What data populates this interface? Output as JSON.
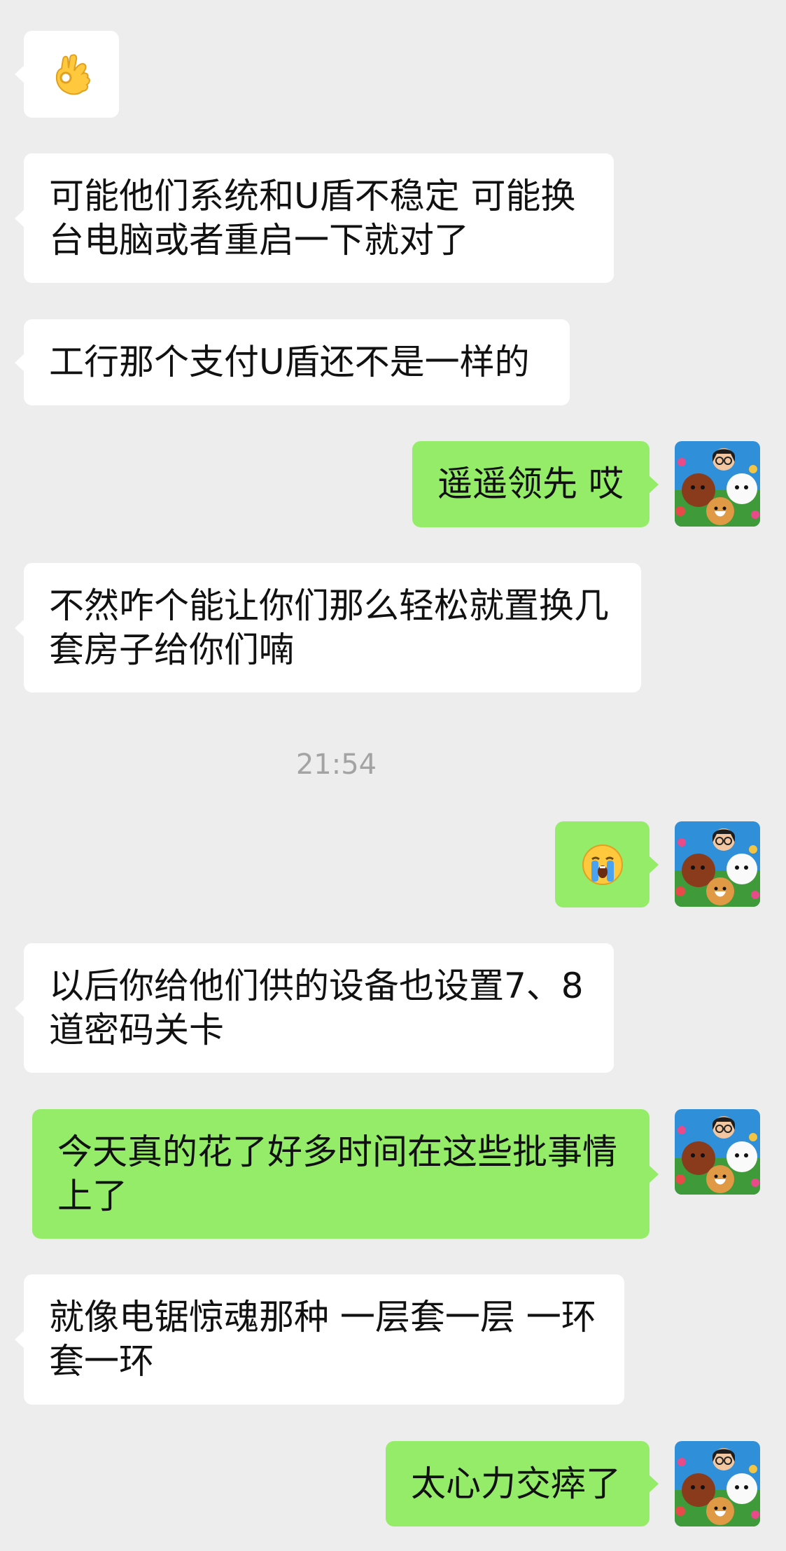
{
  "chat": {
    "timestamp": "21:54",
    "messages": [
      {
        "side": "in",
        "kind": "emoji",
        "emoji": "ok-hand-icon"
      },
      {
        "side": "in",
        "kind": "text",
        "text": "可能他们系统和U盾不稳定 可能换台电脑或者重启一下就对了"
      },
      {
        "side": "in",
        "kind": "text",
        "text": "工行那个支付U盾还不是一样的"
      },
      {
        "side": "out",
        "kind": "text",
        "text": "遥遥领先 哎"
      },
      {
        "side": "in",
        "kind": "text",
        "text": "不然咋个能让你们那么轻松就置换几套房子给你们喃"
      },
      {
        "side": "out",
        "kind": "emoji",
        "emoji": "loudly-crying-face-icon"
      },
      {
        "side": "in",
        "kind": "text",
        "text": "以后你给他们供的设备也设置7、8道密码关卡"
      },
      {
        "side": "out",
        "kind": "text",
        "text": "今天真的花了好多时间在这些批事情上了"
      },
      {
        "side": "in",
        "kind": "text",
        "text": "就像电锯惊魂那种 一层套一层 一环套一环"
      },
      {
        "side": "out",
        "kind": "text",
        "text": "太心力交瘁了"
      }
    ]
  },
  "colors": {
    "background": "#ededed",
    "incoming_bubble": "#ffffff",
    "outgoing_bubble": "#95ec69",
    "timestamp_text": "#a3a3a3"
  }
}
